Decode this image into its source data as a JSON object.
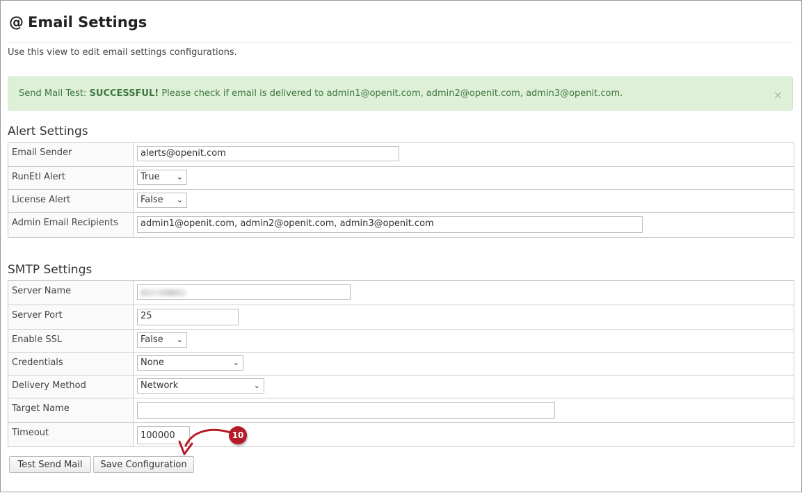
{
  "header": {
    "icon": "at-icon",
    "icon_glyph": "@",
    "title": "Email Settings",
    "description": "Use this view to edit email settings configurations."
  },
  "alert": {
    "prefix": "Send Mail Test: ",
    "status": "SUCCESSFUL!",
    "message": " Please check if email is delivered to admin1@openit.com, admin2@openit.com, admin3@openit.com.",
    "close": "×",
    "color": "#dff0d8"
  },
  "alert_settings": {
    "title": "Alert Settings",
    "rows": [
      {
        "label": "Email Sender",
        "value": "alerts@openit.com"
      },
      {
        "label": "RunEtl Alert",
        "value": "True"
      },
      {
        "label": "License Alert",
        "value": "False"
      },
      {
        "label": "Admin Email Recipients",
        "value": "admin1@openit.com, admin2@openit.com, admin3@openit.com"
      }
    ]
  },
  "smtp_settings": {
    "title": "SMTP Settings",
    "rows": [
      {
        "label": "Server Name",
        "value": ""
      },
      {
        "label": "Server Port",
        "value": "25"
      },
      {
        "label": "Enable SSL",
        "value": "False"
      },
      {
        "label": "Credentials",
        "value": "None"
      },
      {
        "label": "Delivery Method",
        "value": "Network"
      },
      {
        "label": "Target Name",
        "value": ""
      },
      {
        "label": "Timeout",
        "value": "100000"
      }
    ]
  },
  "buttons": {
    "test_send_mail": "Test Send Mail",
    "save_configuration": "Save Configuration"
  },
  "callout": {
    "number": "10",
    "color": "#b51a26"
  }
}
